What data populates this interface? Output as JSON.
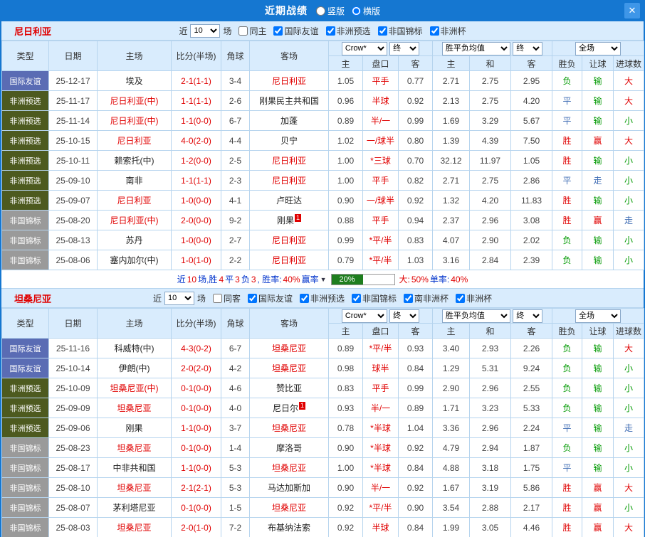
{
  "titlebar": {
    "title": "近期战绩",
    "layout_options": [
      {
        "label": "竖版",
        "selected": false
      },
      {
        "label": "横版",
        "selected": true
      }
    ],
    "close_icon": "✕"
  },
  "result_color_map": {
    "胜": "red",
    "赢": "red",
    "大": "red",
    "负": "green",
    "输": "green",
    "小": "green",
    "平": "blue",
    "走": "blue"
  },
  "table_header": {
    "type": "类型",
    "date": "日期",
    "home": "主场",
    "score": "比分(半场)",
    "corner": "角球",
    "away": "客场",
    "odds_group_select": "Crow*",
    "odds_group_final": "终",
    "avg_group_select": "胜平负均值",
    "avg_group_final": "终",
    "result_group_select": "全场",
    "odds_home": "主",
    "odds_handicap": "盘口",
    "odds_away": "客",
    "avg_home": "主",
    "avg_draw": "和",
    "avg_away": "客",
    "result_wl": "胜负",
    "result_handicap": "让球",
    "result_goals": "进球数"
  },
  "sections": [
    {
      "team": "尼日利亚",
      "filters": {
        "prefix": "近",
        "count": "10",
        "suffix": "场",
        "checkboxes": [
          {
            "label": "同主",
            "checked": false
          },
          {
            "label": "国际友谊",
            "checked": true
          },
          {
            "label": "非洲预选",
            "checked": true
          },
          {
            "label": "非国锦标",
            "checked": true
          },
          {
            "label": "非洲杯",
            "checked": true
          }
        ]
      },
      "rows": [
        {
          "type": "国际友谊",
          "type_class": "t-friendly",
          "date": "25-12-17",
          "home": {
            "name": "埃及",
            "focal": false
          },
          "score": "2-1(1-1)",
          "corner": "3-4",
          "away": {
            "name": "尼日利亚",
            "focal": true
          },
          "odds": [
            "1.05",
            "平手",
            "0.77"
          ],
          "avg": [
            "2.71",
            "2.75",
            "2.95"
          ],
          "results": [
            "负",
            "输",
            "大"
          ]
        },
        {
          "type": "非洲预选",
          "type_class": "t-qualifier",
          "date": "25-11-17",
          "home": {
            "name": "尼日利亚(中)",
            "focal": true
          },
          "score": "1-1(1-1)",
          "corner": "2-6",
          "away": {
            "name": "刚果民主共和国",
            "focal": false
          },
          "odds": [
            "0.96",
            "半球",
            "0.92"
          ],
          "avg": [
            "2.13",
            "2.75",
            "4.20"
          ],
          "results": [
            "平",
            "输",
            "大"
          ]
        },
        {
          "type": "非洲预选",
          "type_class": "t-qualifier",
          "date": "25-11-14",
          "home": {
            "name": "尼日利亚(中)",
            "focal": true
          },
          "score": "1-1(0-0)",
          "corner": "6-7",
          "away": {
            "name": "加蓬",
            "focal": false
          },
          "odds": [
            "0.89",
            "半/一",
            "0.99"
          ],
          "avg": [
            "1.69",
            "3.29",
            "5.67"
          ],
          "results": [
            "平",
            "输",
            "小"
          ]
        },
        {
          "type": "非洲预选",
          "type_class": "t-qualifier",
          "date": "25-10-15",
          "home": {
            "name": "尼日利亚",
            "focal": true
          },
          "score": "4-0(2-0)",
          "corner": "4-4",
          "away": {
            "name": "贝宁",
            "focal": false
          },
          "odds": [
            "1.02",
            "一/球半",
            "0.80"
          ],
          "avg": [
            "1.39",
            "4.39",
            "7.50"
          ],
          "results": [
            "胜",
            "赢",
            "大"
          ]
        },
        {
          "type": "非洲预选",
          "type_class": "t-qualifier",
          "date": "25-10-11",
          "home": {
            "name": "赖索托(中)",
            "focal": false
          },
          "score": "1-2(0-0)",
          "corner": "2-5",
          "away": {
            "name": "尼日利亚",
            "focal": true
          },
          "odds": [
            "1.00",
            "*三球",
            "0.70"
          ],
          "avg": [
            "32.12",
            "11.97",
            "1.05"
          ],
          "results": [
            "胜",
            "输",
            "小"
          ]
        },
        {
          "type": "非洲预选",
          "type_class": "t-qualifier",
          "date": "25-09-10",
          "home": {
            "name": "南非",
            "focal": false
          },
          "score": "1-1(1-1)",
          "corner": "2-3",
          "away": {
            "name": "尼日利亚",
            "focal": true
          },
          "odds": [
            "1.00",
            "平手",
            "0.82"
          ],
          "avg": [
            "2.71",
            "2.75",
            "2.86"
          ],
          "results": [
            "平",
            "走",
            "小"
          ]
        },
        {
          "type": "非洲预选",
          "type_class": "t-qualifier",
          "date": "25-09-07",
          "home": {
            "name": "尼日利亚",
            "focal": true
          },
          "score": "1-0(0-0)",
          "corner": "4-1",
          "away": {
            "name": "卢旺达",
            "focal": false
          },
          "odds": [
            "0.90",
            "一/球半",
            "0.92"
          ],
          "avg": [
            "1.32",
            "4.20",
            "11.83"
          ],
          "results": [
            "胜",
            "输",
            "小"
          ]
        },
        {
          "type": "非国锦标",
          "type_class": "t-chan",
          "date": "25-08-20",
          "home": {
            "name": "尼日利亚(中)",
            "focal": true
          },
          "score": "2-0(0-0)",
          "corner": "9-2",
          "away": {
            "name": "刚果",
            "focal": false,
            "badge": "1"
          },
          "odds": [
            "0.88",
            "平手",
            "0.94"
          ],
          "avg": [
            "2.37",
            "2.96",
            "3.08"
          ],
          "results": [
            "胜",
            "赢",
            "走"
          ]
        },
        {
          "type": "非国锦标",
          "type_class": "t-chan",
          "date": "25-08-13",
          "home": {
            "name": "苏丹",
            "focal": false
          },
          "score": "1-0(0-0)",
          "corner": "2-7",
          "away": {
            "name": "尼日利亚",
            "focal": true
          },
          "odds": [
            "0.99",
            "*平/半",
            "0.83"
          ],
          "avg": [
            "4.07",
            "2.90",
            "2.02"
          ],
          "results": [
            "负",
            "输",
            "小"
          ]
        },
        {
          "type": "非国锦标",
          "type_class": "t-chan",
          "date": "25-08-06",
          "home": {
            "name": "塞内加尔(中)",
            "focal": false
          },
          "score": "1-0(1-0)",
          "corner": "2-2",
          "away": {
            "name": "尼日利亚",
            "focal": true
          },
          "odds": [
            "0.79",
            "*平/半",
            "1.03"
          ],
          "avg": [
            "3.16",
            "2.84",
            "2.39"
          ],
          "results": [
            "负",
            "输",
            "小"
          ]
        }
      ],
      "summary": {
        "segments": [
          {
            "text": "近",
            "color": "blue"
          },
          {
            "text": "10",
            "color": "red"
          },
          {
            "text": "场,胜",
            "color": "blue"
          },
          {
            "text": "4",
            "color": "red"
          },
          {
            "text": "平",
            "color": "blue"
          },
          {
            "text": "3",
            "color": "red"
          },
          {
            "text": "负",
            "color": "blue"
          },
          {
            "text": "3",
            "color": "red"
          },
          {
            "text": ", 胜率:",
            "color": "blue"
          },
          {
            "text": "40%",
            "color": "red"
          },
          {
            "text": " 赢率",
            "color": "blue"
          },
          {
            "text": "▼",
            "color": "dark"
          }
        ],
        "bar": {
          "label": "20%",
          "fill_pct": 50
        },
        "tail_segments": [
          {
            "text": "大:",
            "color": "red"
          },
          {
            "text": "50%",
            "color": "red"
          },
          {
            "text": " 单率:",
            "color": "blue"
          },
          {
            "text": "40%",
            "color": "red"
          }
        ]
      }
    },
    {
      "team": "坦桑尼亚",
      "filters": {
        "prefix": "近",
        "count": "10",
        "suffix": "场",
        "checkboxes": [
          {
            "label": "同客",
            "checked": false
          },
          {
            "label": "国际友谊",
            "checked": true
          },
          {
            "label": "非洲预选",
            "checked": true
          },
          {
            "label": "非国锦标",
            "checked": true
          },
          {
            "label": "南非洲杯",
            "checked": true
          },
          {
            "label": "非洲杯",
            "checked": true
          }
        ]
      },
      "rows": [
        {
          "type": "国际友谊",
          "type_class": "t-friendly",
          "date": "25-11-16",
          "home": {
            "name": "科威特(中)",
            "focal": false
          },
          "score": "4-3(0-2)",
          "corner": "6-7",
          "away": {
            "name": "坦桑尼亚",
            "focal": true
          },
          "odds": [
            "0.89",
            "*平/半",
            "0.93"
          ],
          "avg": [
            "3.40",
            "2.93",
            "2.26"
          ],
          "results": [
            "负",
            "输",
            "大"
          ]
        },
        {
          "type": "国际友谊",
          "type_class": "t-friendly",
          "date": "25-10-14",
          "home": {
            "name": "伊朗(中)",
            "focal": false
          },
          "score": "2-0(2-0)",
          "corner": "4-2",
          "away": {
            "name": "坦桑尼亚",
            "focal": true
          },
          "odds": [
            "0.98",
            "球半",
            "0.84"
          ],
          "avg": [
            "1.29",
            "5.31",
            "9.24"
          ],
          "results": [
            "负",
            "输",
            "小"
          ]
        },
        {
          "type": "非洲预选",
          "type_class": "t-qualifier",
          "date": "25-10-09",
          "home": {
            "name": "坦桑尼亚(中)",
            "focal": true
          },
          "score": "0-1(0-0)",
          "corner": "4-6",
          "away": {
            "name": "赞比亚",
            "focal": false
          },
          "odds": [
            "0.83",
            "平手",
            "0.99"
          ],
          "avg": [
            "2.90",
            "2.96",
            "2.55"
          ],
          "results": [
            "负",
            "输",
            "小"
          ]
        },
        {
          "type": "非洲预选",
          "type_class": "t-qualifier",
          "date": "25-09-09",
          "home": {
            "name": "坦桑尼亚",
            "focal": true
          },
          "score": "0-1(0-0)",
          "corner": "4-0",
          "away": {
            "name": "尼日尔",
            "focal": false,
            "badge": "1"
          },
          "odds": [
            "0.93",
            "半/一",
            "0.89"
          ],
          "avg": [
            "1.71",
            "3.23",
            "5.33"
          ],
          "results": [
            "负",
            "输",
            "小"
          ]
        },
        {
          "type": "非洲预选",
          "type_class": "t-qualifier",
          "date": "25-09-06",
          "home": {
            "name": "刚果",
            "focal": false
          },
          "score": "1-1(0-0)",
          "corner": "3-7",
          "away": {
            "name": "坦桑尼亚",
            "focal": true
          },
          "odds": [
            "0.78",
            "*半球",
            "1.04"
          ],
          "avg": [
            "3.36",
            "2.96",
            "2.24"
          ],
          "results": [
            "平",
            "输",
            "走"
          ]
        },
        {
          "type": "非国锦标",
          "type_class": "t-chan",
          "date": "25-08-23",
          "home": {
            "name": "坦桑尼亚",
            "focal": true
          },
          "score": "0-1(0-0)",
          "corner": "1-4",
          "away": {
            "name": "摩洛哥",
            "focal": false
          },
          "odds": [
            "0.90",
            "*半球",
            "0.92"
          ],
          "avg": [
            "4.79",
            "2.94",
            "1.87"
          ],
          "results": [
            "负",
            "输",
            "小"
          ]
        },
        {
          "type": "非国锦标",
          "type_class": "t-chan",
          "date": "25-08-17",
          "home": {
            "name": "中非共和国",
            "focal": false
          },
          "score": "1-1(0-0)",
          "corner": "5-3",
          "away": {
            "name": "坦桑尼亚",
            "focal": true
          },
          "odds": [
            "1.00",
            "*半球",
            "0.84"
          ],
          "avg": [
            "4.88",
            "3.18",
            "1.75"
          ],
          "results": [
            "平",
            "输",
            "小"
          ]
        },
        {
          "type": "非国锦标",
          "type_class": "t-chan",
          "date": "25-08-10",
          "home": {
            "name": "坦桑尼亚",
            "focal": true
          },
          "score": "2-1(2-1)",
          "corner": "5-3",
          "away": {
            "name": "马达加斯加",
            "focal": false
          },
          "odds": [
            "0.90",
            "半/一",
            "0.92"
          ],
          "avg": [
            "1.67",
            "3.19",
            "5.86"
          ],
          "results": [
            "胜",
            "赢",
            "大"
          ]
        },
        {
          "type": "非国锦标",
          "type_class": "t-chan",
          "date": "25-08-07",
          "home": {
            "name": "茅利塔尼亚",
            "focal": false
          },
          "score": "0-1(0-0)",
          "corner": "1-5",
          "away": {
            "name": "坦桑尼亚",
            "focal": true
          },
          "odds": [
            "0.92",
            "*平/半",
            "0.90"
          ],
          "avg": [
            "3.54",
            "2.88",
            "2.17"
          ],
          "results": [
            "胜",
            "赢",
            "小"
          ]
        },
        {
          "type": "非国锦标",
          "type_class": "t-chan",
          "date": "25-08-03",
          "home": {
            "name": "坦桑尼亚",
            "focal": true
          },
          "score": "2-0(1-0)",
          "corner": "7-2",
          "away": {
            "name": "布基纳法索",
            "focal": false
          },
          "odds": [
            "0.92",
            "半球",
            "0.84"
          ],
          "avg": [
            "1.99",
            "3.05",
            "4.46"
          ],
          "results": [
            "胜",
            "赢",
            "大"
          ]
        }
      ],
      "summary": null
    }
  ]
}
